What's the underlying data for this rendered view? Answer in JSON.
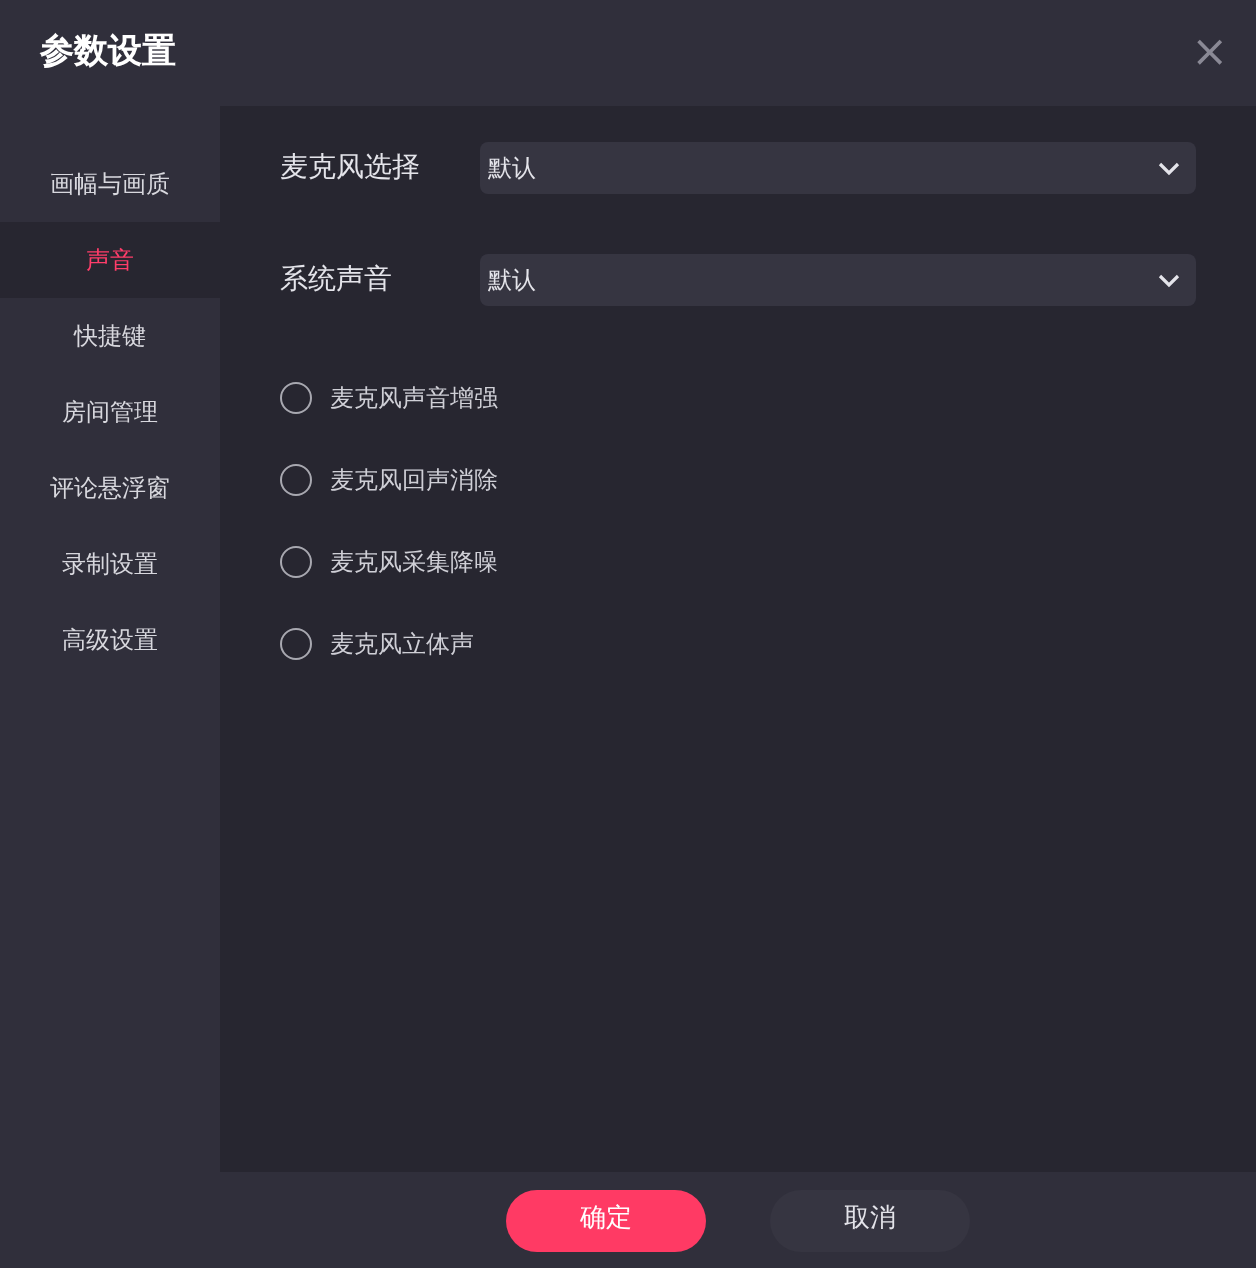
{
  "window": {
    "title": "参数设置",
    "close": "×"
  },
  "sidebar": {
    "items": [
      {
        "label": "画幅与画质",
        "selected": false
      },
      {
        "label": "声音",
        "selected": true
      },
      {
        "label": "快捷键",
        "selected": false
      },
      {
        "label": "房间管理",
        "selected": false
      },
      {
        "label": "评论悬浮窗",
        "selected": false
      },
      {
        "label": "录制设置",
        "selected": false
      },
      {
        "label": "高级设置",
        "selected": false
      }
    ]
  },
  "selects": [
    {
      "label": "麦克风选择",
      "value": "默认"
    },
    {
      "label": "系统声音",
      "value": "默认"
    }
  ],
  "options": [
    {
      "label": "麦克风声音增强",
      "checked": false
    },
    {
      "label": "麦克风回声消除",
      "checked": false
    },
    {
      "label": "麦克风采集降噪",
      "checked": false
    },
    {
      "label": "麦克风立体声",
      "checked": false
    }
  ],
  "buttons": [
    {
      "label": "确定",
      "kind": "primary"
    },
    {
      "label": "取消",
      "kind": "secondary"
    }
  ]
}
